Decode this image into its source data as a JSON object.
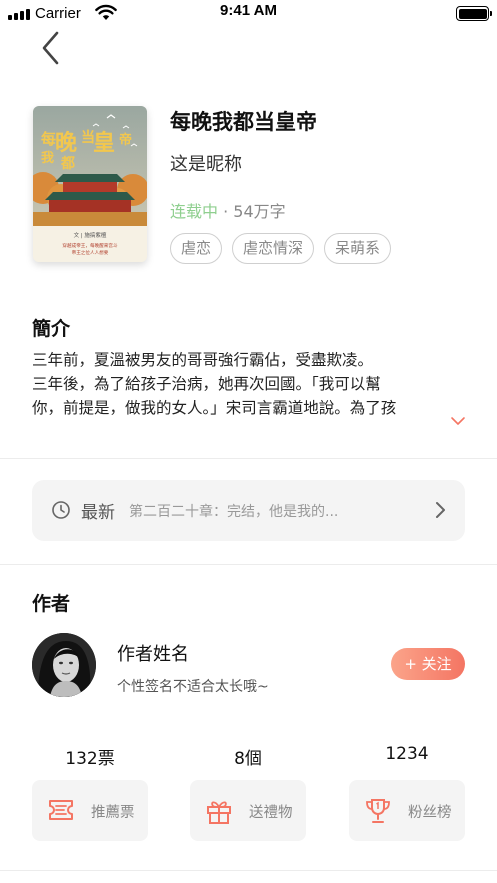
{
  "status_bar": {
    "carrier": "Carrier",
    "time": "9:41 AM"
  },
  "book": {
    "title": "每晚我都当皇帝",
    "nickname": "这是昵称",
    "serial_status": "连载中",
    "separator": "·",
    "word_count": "54万字",
    "tags": [
      "虐恋",
      "虐恋情深",
      "呆萌系"
    ],
    "cover": {
      "title_chars": [
        "每",
        "晚",
        "我",
        "都",
        "当",
        "皇",
        "帝"
      ],
      "author_line": "文 | 施搞紫檀",
      "promo_line_1": "穿越成帝王，每晚醒来宫斗",
      "promo_line_2": "帝王之位人人想要"
    }
  },
  "intro": {
    "heading": "簡介",
    "lines": [
      "三年前，夏溫被男友的哥哥強行霸佔，受盡欺凌。",
      "三年後，為了給孩子治病，她再次回國。「我可以幫",
      "你，前提是，做我的女人。」宋司言霸道地說。為了孩"
    ]
  },
  "latest": {
    "label": "最新",
    "chapter": "第二百二十章：完结，他是我的..."
  },
  "author": {
    "heading": "作者",
    "name": "作者姓名",
    "signature": "个性签名不适合太长哦~",
    "follow_label": "+ 关注"
  },
  "stats": [
    {
      "count": "132票",
      "label": "推薦票",
      "icon": "ticket-icon"
    },
    {
      "count": "8個",
      "label": "送禮物",
      "icon": "gift-icon"
    },
    {
      "count": "1234",
      "label": "粉丝榜",
      "icon": "trophy-icon"
    }
  ],
  "colors": {
    "accent": "#f47563",
    "serial_green": "#8fcf8f",
    "card_bg": "#f4f4f4"
  }
}
